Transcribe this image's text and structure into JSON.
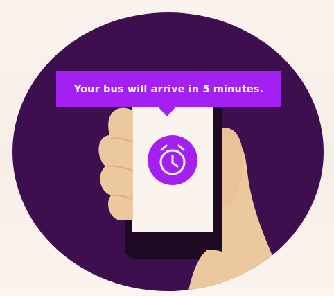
{
  "notification": {
    "message": "Your bus will arrive in 5 minutes."
  },
  "icons": {
    "alarm": "alarm-clock-icon"
  },
  "colors": {
    "background": "#fbf1ec",
    "circle": "#3e0f4e",
    "accent": "#a31ff2",
    "skin": "#ecc89f",
    "phone_body": "#1f0a24",
    "phone_screen": "#fbf3ee"
  }
}
